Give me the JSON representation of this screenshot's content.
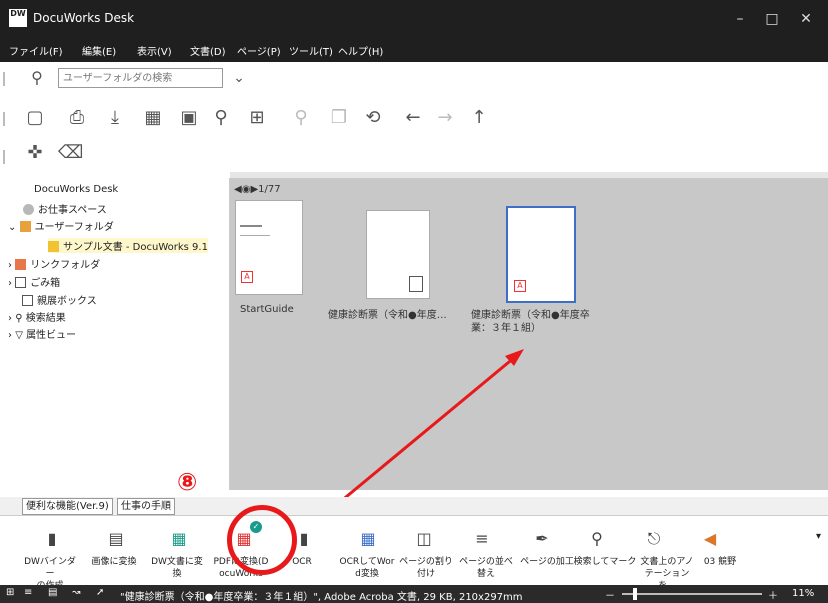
{
  "window": {
    "title": "DocuWorks Desk",
    "icon_text": "DW",
    "minimize": "–",
    "maximize": "□",
    "close": "✕"
  },
  "menu": [
    "ファイル(F)",
    "編集(E)",
    "表示(V)",
    "文書(D)",
    "ページ(P)",
    "ツール(T)",
    "ヘルプ(H)"
  ],
  "search": {
    "placeholder": "ユーザーフォルダの検索"
  },
  "sidebar": {
    "root": "DocuWorks Desk",
    "items": [
      {
        "label": "お仕事スペース"
      },
      {
        "label": "ユーザーフォルダ"
      },
      {
        "label": "サンプル文書 - DocuWorks 9.1"
      },
      {
        "label": "リンクフォルダ"
      },
      {
        "label": "ごみ箱"
      },
      {
        "label": "親展ボックス"
      },
      {
        "label": "検索結果"
      },
      {
        "label": "属性ビュー"
      }
    ]
  },
  "content": {
    "page_indicator": "1/77",
    "documents": [
      {
        "label1": "StartGuide",
        "label2": ""
      },
      {
        "label1": "健康診断票（令和●年度…",
        "label2": ""
      },
      {
        "label1": "健康診断票（令和●年度卒",
        "label2": "業：３年１組）"
      }
    ]
  },
  "tabs": [
    "便利な機能(Ver.9)",
    "仕事の手順"
  ],
  "annotation": {
    "number": "⑧",
    "color": "#e8191b"
  },
  "functions": [
    {
      "line1": "DWバインダー",
      "line2": "の作成"
    },
    {
      "line1": "画像に変換",
      "line2": ""
    },
    {
      "line1": "DW文書に変",
      "line2": "換"
    },
    {
      "line1": "PDFに変換(D",
      "line2": "ocuWorks"
    },
    {
      "line1": "OCR",
      "line2": ""
    },
    {
      "line1": "OCRしてWor",
      "line2": "d変換"
    },
    {
      "line1": "ページの割り",
      "line2": "付け"
    },
    {
      "line1": "ページの並べ",
      "line2": "替え"
    },
    {
      "line1": "ページの加工",
      "line2": ""
    },
    {
      "line1": "検索してマーク",
      "line2": ""
    },
    {
      "line1": "文書上のアノ",
      "line2": "テーションを..."
    },
    {
      "line1": "03 競野",
      "line2": ""
    }
  ],
  "status": {
    "text": "\"健康診断票（令和●年度卒業：３年１組）\", Adobe Acroba 文書, 29 KB, 210x297mm",
    "zoom": "11%",
    "minus": "－",
    "plus": "＋"
  }
}
